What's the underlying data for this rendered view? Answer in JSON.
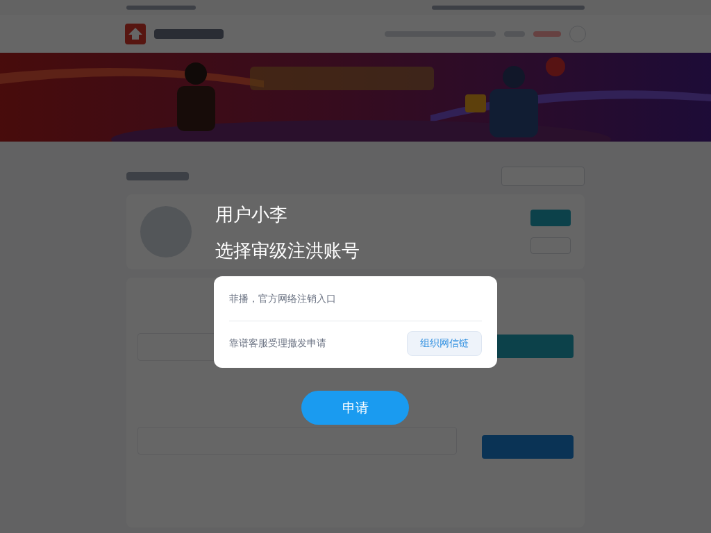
{
  "overlay": {
    "title": "用户小李",
    "subtitle": "选择审级注洪账号"
  },
  "dialog": {
    "rows": [
      {
        "kind": "text",
        "label": "菲播，官方网络注销入口"
      },
      {
        "kind": "action",
        "label": "靠谱客服受理撤发申请",
        "button": "组织网信链"
      }
    ]
  },
  "submit_button": "申请"
}
